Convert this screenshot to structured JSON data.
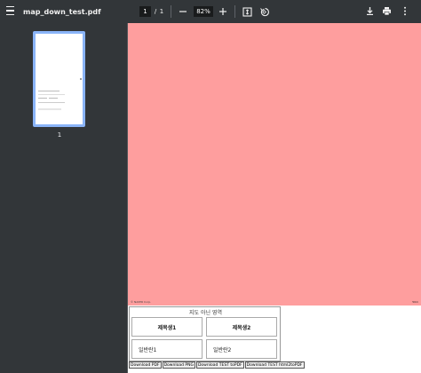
{
  "toolbar": {
    "title": "map_down_test.pdf",
    "page_current": "1",
    "page_separator": "/",
    "page_total": "1",
    "zoom_level": "82%",
    "zoom_out_symbol": "−",
    "zoom_in_symbol": "+"
  },
  "sidebar": {
    "thumbnails": [
      {
        "label": "1"
      }
    ]
  },
  "document": {
    "map_color": "#fe9e9e",
    "map_attribution": "© NAVER Corp.",
    "map_scale_label": "50m",
    "table": {
      "title": "지도 아닌 영역",
      "headers": [
        "제목생1",
        "제목생2"
      ],
      "cells": [
        "일반란1",
        "일반란2"
      ]
    },
    "buttons": [
      "Download PDF",
      "Download PNG",
      "Download TEST toPDF",
      "Download TEST html2toPDF"
    ]
  },
  "colors": {
    "toolbar_bg": "#323639",
    "viewer_bg": "#525659",
    "thumb_border": "#8ab4f8"
  },
  "icons": [
    "menu-icon",
    "zoom-out-icon",
    "zoom-in-icon",
    "fit-page-icon",
    "rotate-icon",
    "download-icon",
    "print-icon",
    "more-vert-icon"
  ]
}
